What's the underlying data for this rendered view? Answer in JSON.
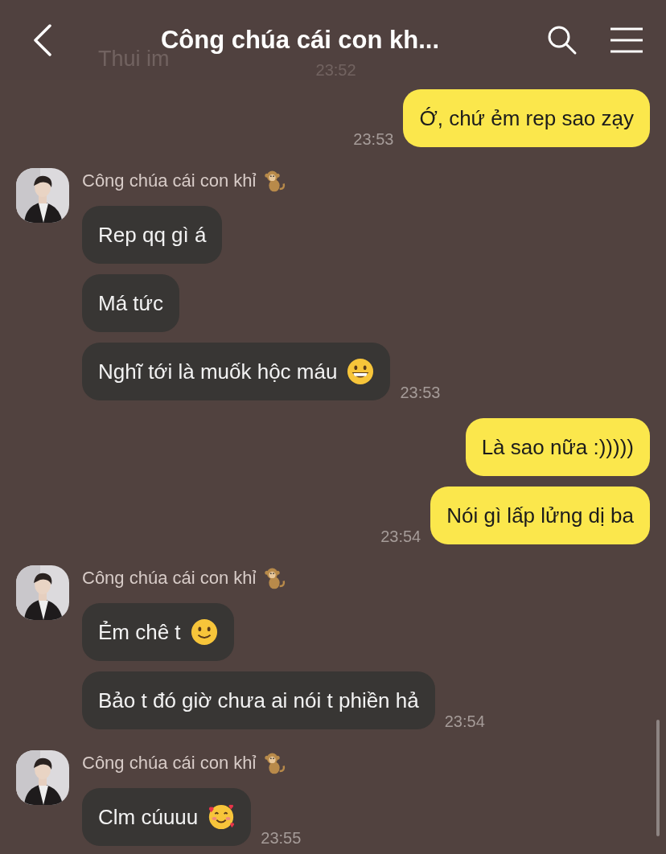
{
  "header": {
    "title": "Công chúa cái con kh..."
  },
  "behind_header": {
    "text": "Thui im",
    "time": "23:52"
  },
  "groups": [
    {
      "kind": "out",
      "messages": [
        {
          "text": "Ớ, chứ ẻm rep sao zạy"
        }
      ],
      "time": "23:53"
    },
    {
      "kind": "in",
      "sender": "Công chúa cái con khỉ",
      "messages": [
        {
          "kind": "plain",
          "text": "Rep qq gì á"
        },
        {
          "kind": "plain",
          "text": "Má tức"
        },
        {
          "kind": "grinning",
          "text": "Nghĩ tới là muốk hộc máu"
        }
      ],
      "time": "23:53"
    },
    {
      "kind": "out",
      "messages": [
        {
          "text": "Là sao nữa :)))))"
        },
        {
          "text": "Nói gì lấp lửng dị ba"
        }
      ],
      "time": "23:54"
    },
    {
      "kind": "in",
      "sender": "Công chúa cái con khỉ",
      "messages": [
        {
          "kind": "smiling",
          "text": "Ẻm chê t"
        },
        {
          "kind": "plain",
          "text": "Bảo t đó giờ chưa ai nói t phiền hả"
        }
      ],
      "time": "23:54"
    },
    {
      "kind": "in",
      "sender": "Công chúa cái con khỉ",
      "messages": [
        {
          "kind": "hearts",
          "text": "Clm cúuuu"
        }
      ],
      "time": "23:55"
    }
  ]
}
